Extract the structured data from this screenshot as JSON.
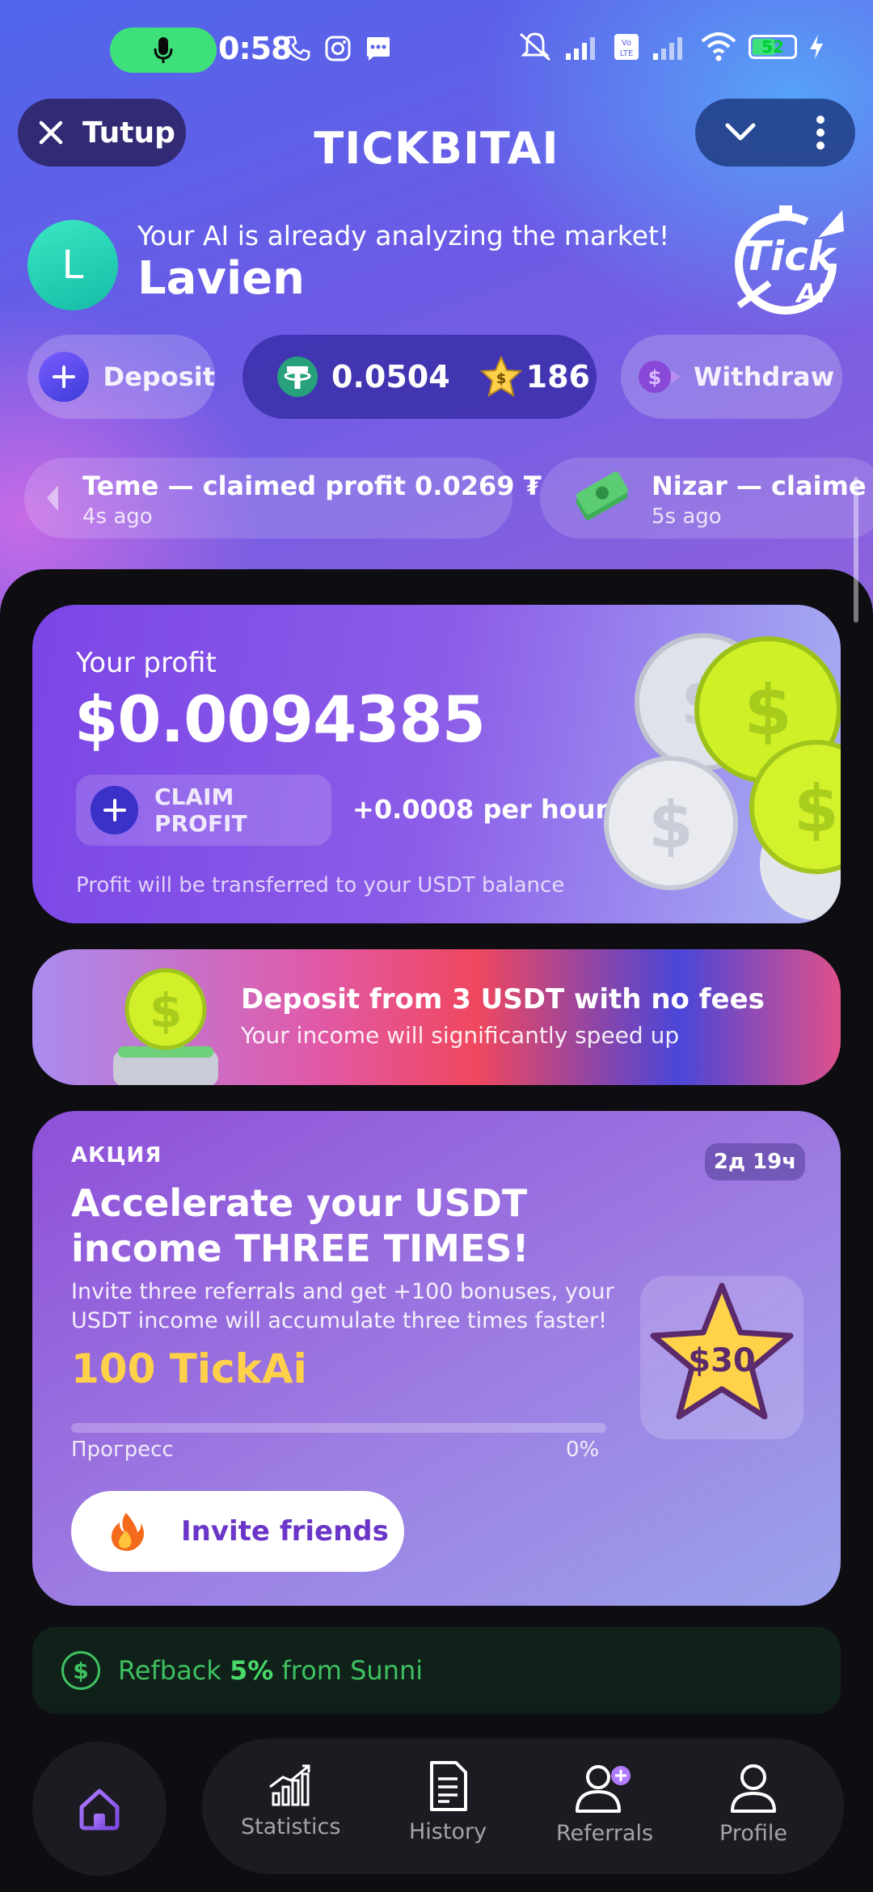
{
  "statusbar": {
    "time": "0:58",
    "battery": "52"
  },
  "header": {
    "close_label": "Tutup",
    "title": "TICKBITAI"
  },
  "user": {
    "initial": "L",
    "tagline": "Your AI is already analyzing the market!",
    "name": "Lavien"
  },
  "logo": {
    "line1": "Tick",
    "line2": "AI"
  },
  "wallet": {
    "deposit_label": "Deposit",
    "usdt_balance": "0.0504",
    "stars_balance": "186",
    "withdraw_label": "Withdraw"
  },
  "feed": [
    {
      "text": "Teme — claimed profit 0.0269 ₮",
      "ago": "4s ago"
    },
    {
      "text": "Nizar — claime",
      "ago": "5s ago"
    }
  ],
  "profit": {
    "label": "Your profit",
    "value": "$0.0094385",
    "claim_label": "CLAIM PROFIT",
    "rate": "+0.0008 per hour",
    "note": "Profit will be transferred to your USDT balance"
  },
  "promo": {
    "title": "Deposit from 3 USDT with no fees",
    "subtitle": "Your income will significantly speed up"
  },
  "action": {
    "tag": "АКЦИЯ",
    "timer": "2д 19ч",
    "title": "Accelerate your USDT income THREE TIMES!",
    "description": "Invite three referrals and get +100 bonuses, your USDT income will accumulate three times faster!",
    "bonus": "100 TickAi",
    "progress_label": "Прогресс",
    "progress_value": "0%",
    "progress_fraction": 0,
    "star_value": "$30",
    "invite_label": "Invite friends"
  },
  "refback": {
    "prefix": "Refback ",
    "amount": "5%",
    "suffix": " from Sunni"
  },
  "nav": {
    "statistics": "Statistics",
    "history": "History",
    "referrals": "Referrals",
    "profile": "Profile"
  },
  "colors": {
    "accent": "#6b35c8",
    "bonus": "#ffd04a",
    "green": "#3fc060",
    "usdt": "#26a17b"
  }
}
